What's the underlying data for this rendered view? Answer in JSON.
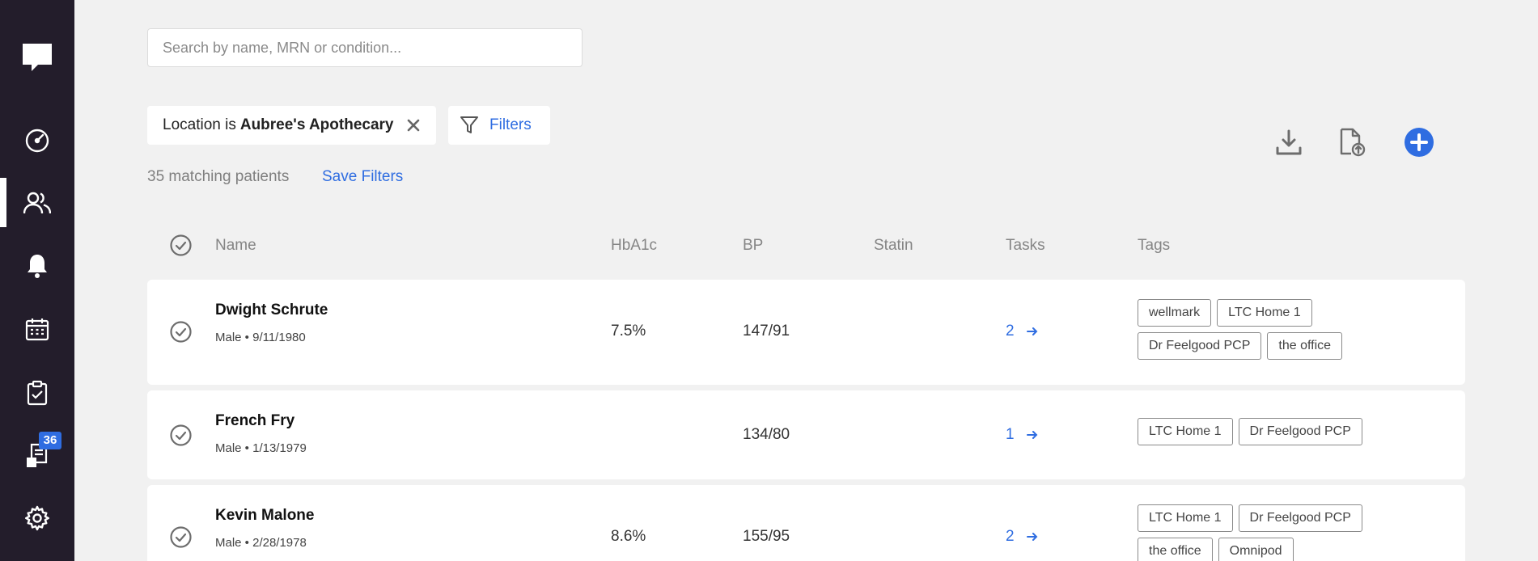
{
  "sidebar": {
    "badge_count": "36",
    "items": [
      {
        "name": "chat-logo-icon"
      },
      {
        "name": "dashboard-gauge-icon"
      },
      {
        "name": "patients-icon",
        "active": true
      },
      {
        "name": "bell-icon"
      },
      {
        "name": "calendar-icon"
      },
      {
        "name": "clipboard-check-icon"
      },
      {
        "name": "documents-icon"
      },
      {
        "name": "gear-icon"
      }
    ]
  },
  "search": {
    "placeholder": "Search by name, MRN or condition..."
  },
  "filter_chip": {
    "label": "Location is",
    "value": "Aubree's Apothecary"
  },
  "filters_button": {
    "label": "Filters"
  },
  "match_count": "35 matching patients",
  "save_filters": "Save Filters",
  "table": {
    "headers": {
      "name": "Name",
      "hba1c": "HbA1c",
      "bp": "BP",
      "statin": "Statin",
      "tasks": "Tasks",
      "tags": "Tags"
    },
    "rows": [
      {
        "name": "Dwight Schrute",
        "sub": "Male • 9/11/1980",
        "hba1c": "7.5%",
        "bp": "147/91",
        "statin": "",
        "tasks": "2",
        "tags": [
          "wellmark",
          "LTC Home 1",
          "Dr Feelgood PCP",
          "the office"
        ]
      },
      {
        "name": "French Fry",
        "sub": "Male • 1/13/1979",
        "hba1c": "",
        "bp": "134/80",
        "statin": "",
        "tasks": "1",
        "tags": [
          "LTC Home 1",
          "Dr Feelgood PCP"
        ]
      },
      {
        "name": "Kevin Malone",
        "sub": "Male • 2/28/1978",
        "hba1c": "8.6%",
        "bp": "155/95",
        "statin": "",
        "tasks": "2",
        "tags": [
          "LTC Home 1",
          "Dr Feelgood PCP",
          "the office",
          "Omnipod"
        ]
      }
    ]
  },
  "colors": {
    "sidebar": "#231d2b",
    "accent": "#2f6de1",
    "background": "#f1f1f1"
  }
}
